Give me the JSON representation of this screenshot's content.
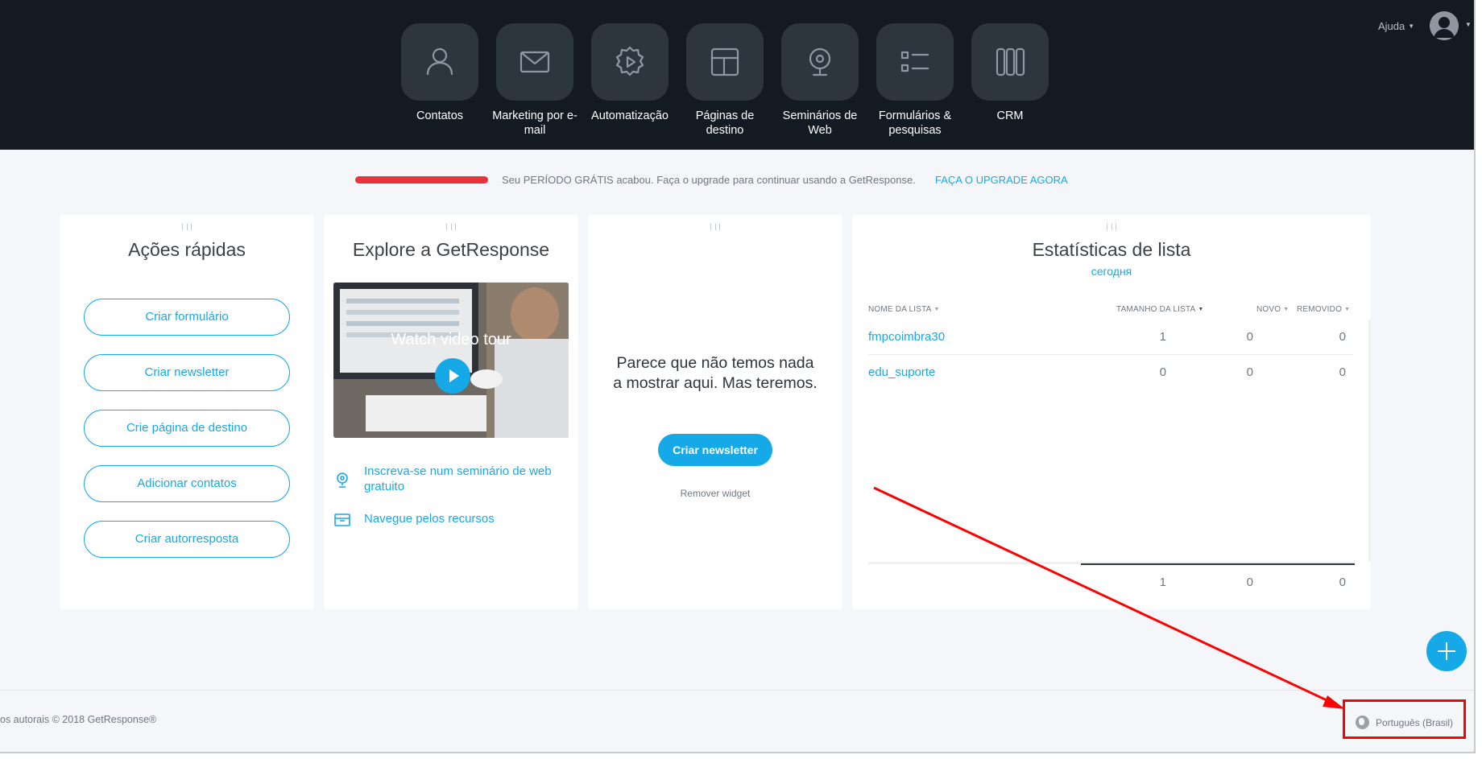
{
  "nav": {
    "items": [
      {
        "label": "Contatos",
        "icon": "person-icon"
      },
      {
        "label": "Marketing por e-mail",
        "icon": "envelope-icon"
      },
      {
        "label": "Automatização",
        "icon": "gear-play-icon"
      },
      {
        "label": "Páginas de destino",
        "icon": "layout-icon"
      },
      {
        "label": "Seminários de Web",
        "icon": "webcam-icon"
      },
      {
        "label": "Formulários & pesquisas",
        "icon": "form-list-icon"
      },
      {
        "label": "CRM",
        "icon": "columns-icon"
      }
    ],
    "help_label": "Ajuda"
  },
  "trial": {
    "message": "Seu PERÍODO GRÁTIS acabou. Faça o upgrade para continuar usando a GetResponse.",
    "cta": "FAÇA O UPGRADE AGORA"
  },
  "quick_actions": {
    "title": "Ações rápidas",
    "buttons": [
      "Criar formulário",
      "Criar newsletter",
      "Crie página de destino",
      "Adicionar contatos",
      "Criar autorresposta"
    ]
  },
  "explore": {
    "title": "Explore a GetResponse",
    "video_caption": "Watch video tour",
    "links": [
      {
        "label": "Inscreva-se num seminário de web gratuito",
        "icon": "webcam-icon"
      },
      {
        "label": "Navegue pelos recursos",
        "icon": "box-icon"
      }
    ]
  },
  "empty_widget": {
    "message": "Parece que não temos nada a mostrar aqui. Mas teremos.",
    "button": "Criar newsletter",
    "remove": "Remover widget"
  },
  "list_stats": {
    "title": "Estatísticas de lista",
    "period": "сегодня",
    "columns": [
      "NOME DA LISTA",
      "TAMANHO DA LISTA",
      "NOVO",
      "REMOVIDO"
    ],
    "rows": [
      {
        "name": "fmpcoimbra30",
        "size": "1",
        "new": "0",
        "removed": "0"
      },
      {
        "name": "edu_suporte",
        "size": "0",
        "new": "0",
        "removed": "0"
      }
    ],
    "totals": {
      "size": "1",
      "new": "0",
      "removed": "0"
    }
  },
  "footer": {
    "copyright": "os autorais © 2018 GetResponse®",
    "language": "Português (Brasil)"
  },
  "colors": {
    "accent": "#16a9e8",
    "topbar": "#131a22",
    "alert": "#e8333c",
    "annotation": "#ff0000"
  }
}
